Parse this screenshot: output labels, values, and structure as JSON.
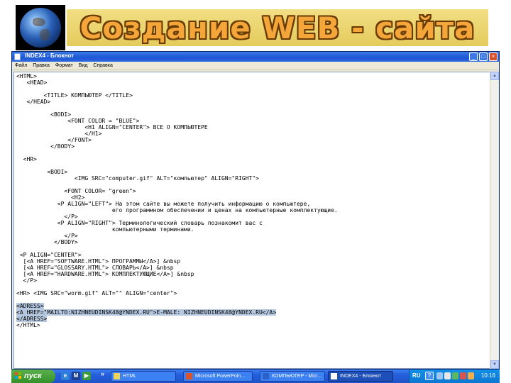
{
  "slide": {
    "title": "Создание WEB - сайта"
  },
  "notepad": {
    "title": "INDEX4 - Блокнот",
    "controls": {
      "minimize": "_",
      "maximize": "□",
      "close": "×"
    },
    "menu": [
      "Файл",
      "Правка",
      "Формат",
      "Вид",
      "Справка"
    ],
    "code_lines": [
      "<HTML>",
      "   <HEAD>",
      "",
      "        <TITLE> КОМПЬЮТЕР </TITLE>",
      "   </HEAD>",
      "",
      "          <BODI>",
      "               <FONT COLOR = \"BLUE\">",
      "                    <H1 ALIGN=\"CENTER\"> ВСЕ О КОМПЬЮТЕРЕ",
      "                    </H1>",
      "               </FONT>",
      "          </BODY>",
      "",
      "  <HR>",
      "",
      "         <BODI>",
      "                 <IMG SRC=\"computer.gif\" ALT=\"компьютер\" ALIGN=\"RIGHT\">",
      "",
      "              <FONT COLOR= \"green\">",
      "                <H2>",
      "            <P ALIGN=\"LEFT\"> На этом сайте вы можете получить информацию о компьютере,",
      "                            его программном обеспечении и ценах на компьютерные комплектующие.",
      "              </P>",
      "            <P ALIGN=\"RIGHT\"> Терминологический словарь познакомит вас с",
      "                            компьютерными терминами.",
      "              </P>",
      "           </BODY>",
      "",
      " <P ALIGN=\"CENTER\">",
      "  [<A HREF=\"SOFTWARE.HTML\"> ПРОГРАММЫ</A>] &nbsp",
      "  [<A HREF=\"GLOSSARY.HTML\"> СЛОВАРЬ</A>] &nbsp",
      "  [<A HREF=\"HARDWARE.HTML\"> КОМПЛЕКТУЮЩИЕ</A>] &nbsp",
      "  </P>",
      "",
      "<HR> <IMG SRC=\"worm.gif\" ALT=\"\" ALIGN=\"center\">",
      "",
      "<ADRESS>",
      "<A HREF=\"MAILTO:NIZHNEUDINSK48@YNDEX.RU\">E-MALE: NIZHNEUDINSK48@YNDEX.RU</A>",
      "</ADRESS>",
      "</HTML>"
    ],
    "selected_lines": [
      36,
      37,
      38
    ]
  },
  "taskbar": {
    "start_label": "пуск",
    "quick_launch_more": "»",
    "tasks": [
      {
        "label": "HTML",
        "active": false,
        "icon_color": "#f2d35a"
      },
      {
        "label": "Microsoft PowerPoin...",
        "active": false,
        "icon_color": "#d9542b"
      },
      {
        "label": "КОМПЬЮТЕР - Micr...",
        "active": false,
        "icon_color": "#2b62c9"
      },
      {
        "label": "INDEX4 - Блокнот",
        "active": true,
        "icon_color": "#ffffff"
      }
    ],
    "tray": {
      "language": "RU",
      "help": "?",
      "time": "10:16"
    }
  },
  "colors": {
    "title_fill": "#f4a63a",
    "title_band": "#e8d26a",
    "selection": "#b5c8e0",
    "taskbar": "#245edb",
    "start": "#36912a"
  }
}
